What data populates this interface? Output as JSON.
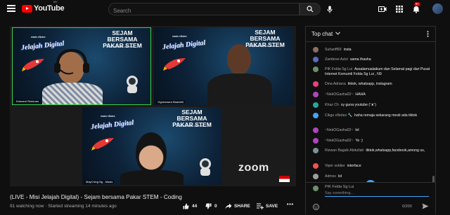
{
  "header": {
    "logo_text": "YouTube",
    "country": "MY",
    "search_placeholder": "Search",
    "notifications_count": "9+",
    "icons": [
      "menu-icon",
      "search-icon",
      "mic-icon",
      "create-video-icon",
      "apps-grid-icon",
      "bell-icon"
    ]
  },
  "video": {
    "tiles": [
      {
        "brand": "masis  eNotes",
        "title": "Jelajah Digital",
        "headline": "SEJAM BERSAMA PAKAR STEM",
        "sub": "Dibawakan khas oleh masis",
        "name": "Kamarul Redzuan"
      },
      {
        "brand": "masis  eNotes",
        "title": "Jelajah Digital",
        "headline": "SEJAM BERSAMA PAKAR STEM",
        "sub": "Dibawakan khas oleh masis",
        "name": "Vigneswara Baarathi"
      },
      {
        "brand": "masis  eNotes",
        "title": "Jelajah Digital",
        "headline": "SEJAM BERSAMA PAKAR STEM",
        "sub": "Dibawakan khas oleh masis",
        "name": "MayChing Ng - Masis"
      }
    ],
    "watermark": "zoom",
    "title": "(LIVE - Misi Jelajah Digital) - Sejam bersama Pakar STEM - Coding",
    "meta": "91 watching now · Started streaming 14 minutes ago",
    "likes": "44",
    "dislikes": "0",
    "share_label": "SHARE",
    "save_label": "SAVE"
  },
  "chat": {
    "mode_label": "Top chat",
    "messages": [
      {
        "author": "Suhariff69",
        "text": "insta",
        "color": "#8d6e63"
      },
      {
        "author": "Zambree Azizi",
        "text": "sama thasha",
        "color": "#5c6bc0"
      },
      {
        "author": "PIK Felda Sg Lui",
        "text": "Assalamualaikum dan Selamat pagi dari Pusat Internet Komuniti Felda Sg Lui , N9",
        "color": "#6b8e6b"
      },
      {
        "author": "Dina Adriana",
        "text": "tiktok, whatsapp, instagram",
        "color": "#ec407a"
      },
      {
        "author": "~NekOGaxha02~",
        "text": "HAHA",
        "color": "#ab47bc"
      },
      {
        "author": "Khaz Ch",
        "text": "sy guna youtube (ᵔᴥᵔ)",
        "color": "#26a69a"
      },
      {
        "author": "Cikgu eNotes 🔧",
        "text": "haha remaja sekarang mesti ada tiktok",
        "color": "#42a5f5"
      },
      {
        "author": "~NekOGaxha02~",
        "text": "lol",
        "color": "#ab47bc"
      },
      {
        "author": "~NekOGaxha02~",
        "text": "Ye :)",
        "color": "#ab47bc"
      },
      {
        "author": "Rizwan Bagsik Abdullah",
        "text": "tiktok,whatsapp,facebook,among us,",
        "color": "#78909c"
      },
      {
        "author": "Viper soldier",
        "text": "interface",
        "color": "#ef5350"
      },
      {
        "author": "Admxs",
        "text": "lol",
        "color": "#9e9e9e"
      }
    ],
    "composer_name": "PIK Felda Sg Lui",
    "composer_placeholder": "Say something...",
    "char_count": "0/200"
  },
  "colors": {
    "accent": "#3ea6ff",
    "brand_red": "#ff0000",
    "active_speaker": "#3bd14b"
  }
}
